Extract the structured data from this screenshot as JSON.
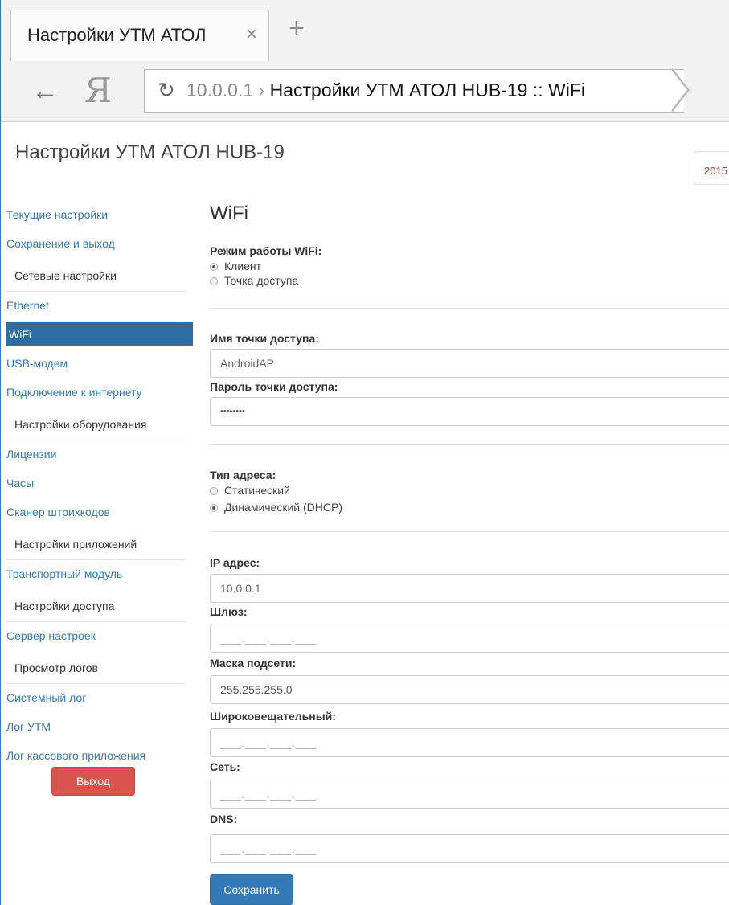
{
  "browser": {
    "tab_title": "Настройки УТМ АТОЛ",
    "tab_close": "×",
    "new_tab": "+",
    "back": "←",
    "yandex": "Я",
    "reload": "↻",
    "url_host": "10.0.0.1",
    "url_sep": " › ",
    "url_title": "Настройки УТМ АТОЛ HUB-19 :: WiFi"
  },
  "header": {
    "brand": "Настройки УТМ АТОЛ HUB-19",
    "year": "2015"
  },
  "sidebar": {
    "items": [
      {
        "type": "link",
        "label": "Текущие настройки"
      },
      {
        "type": "link",
        "label": "Сохранение и выход"
      },
      {
        "type": "header",
        "label": "Сетевые настройки"
      },
      {
        "type": "link",
        "label": "Ethernet"
      },
      {
        "type": "active",
        "label": "WiFi"
      },
      {
        "type": "link",
        "label": "USB-модем"
      },
      {
        "type": "link",
        "label": "Подключение к интернету"
      },
      {
        "type": "header",
        "label": "Настройки оборудования"
      },
      {
        "type": "link",
        "label": "Лицензии"
      },
      {
        "type": "link",
        "label": "Часы"
      },
      {
        "type": "link",
        "label": "Сканер штрихкодов"
      },
      {
        "type": "header",
        "label": "Настройки приложений"
      },
      {
        "type": "link",
        "label": "Транспортный модуль"
      },
      {
        "type": "header",
        "label": "Настройки доступа"
      },
      {
        "type": "link",
        "label": "Сервер настроек"
      },
      {
        "type": "header",
        "label": "Просмотр логов"
      },
      {
        "type": "link",
        "label": "Системный лог"
      },
      {
        "type": "link",
        "label": "Лог УТМ"
      },
      {
        "type": "link",
        "label": "Лог кассового приложения"
      }
    ],
    "logout_label": "Выход"
  },
  "form": {
    "title": "WiFi",
    "mode_label": "Режим работы WiFi:",
    "mode_options": [
      "Клиент",
      "Точка доступа"
    ],
    "mode_selected": "Клиент",
    "ssid_label": "Имя точки доступа:",
    "ssid_value": "AndroidAP",
    "password_label": "Пароль точки доступа:",
    "password_value": "••••••••",
    "addr_type_label": "Тип адреса:",
    "addr_type_options": [
      "Статический",
      "Динамический (DHCP)"
    ],
    "addr_type_selected": "Динамический (DHCP)",
    "ip_label": "IP адрес:",
    "ip_value": "10.0.0.1",
    "gateway_label": "Шлюз:",
    "gateway_placeholder": "___.___.___.___",
    "mask_label": "Маска подсети:",
    "mask_value": "255.255.255.0",
    "broadcast_label": "Широковещательный:",
    "broadcast_placeholder": "___.___.___.___",
    "network_label": "Сеть:",
    "network_placeholder": "___.___.___.___",
    "dns_label": "DNS:",
    "dns_placeholder": "___.___.___.___",
    "save_label": "Сохранить"
  }
}
